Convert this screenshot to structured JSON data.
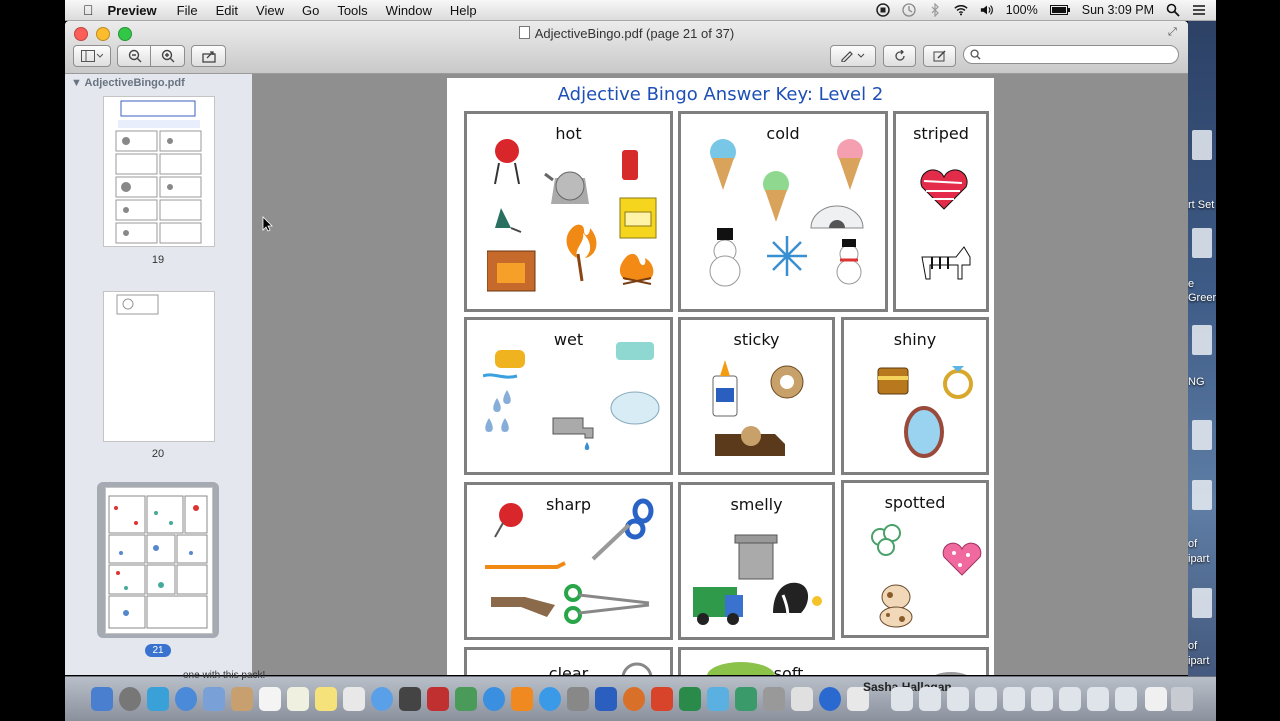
{
  "menubar": {
    "app": "Preview",
    "items": [
      "File",
      "Edit",
      "View",
      "Go",
      "Tools",
      "Window",
      "Help"
    ],
    "battery": "100%",
    "clock": "Sun 3:09 PM"
  },
  "window": {
    "title": "AdjectiveBingo.pdf (page 21 of 37)"
  },
  "search": {
    "placeholder": ""
  },
  "sidebar": {
    "file_label": "AdjectiveBingo.pdf",
    "pages": [
      "19",
      "20",
      "21"
    ],
    "selected": "21"
  },
  "document": {
    "title": "Adjective Bingo Answer Key: Level 2",
    "cells": [
      "hot",
      "cold",
      "striped",
      "wet",
      "sticky",
      "shiny",
      "sharp",
      "smelly",
      "spotted",
      "clear",
      "soft"
    ]
  },
  "desktop": {
    "labels": [
      "rt Set",
      "e",
      "Greer",
      "NG",
      "of",
      "ipart",
      "of",
      "ipart"
    ]
  },
  "dock": {
    "overlay_text": "one with this pack!",
    "user_label": "Sasha Hallagan"
  }
}
